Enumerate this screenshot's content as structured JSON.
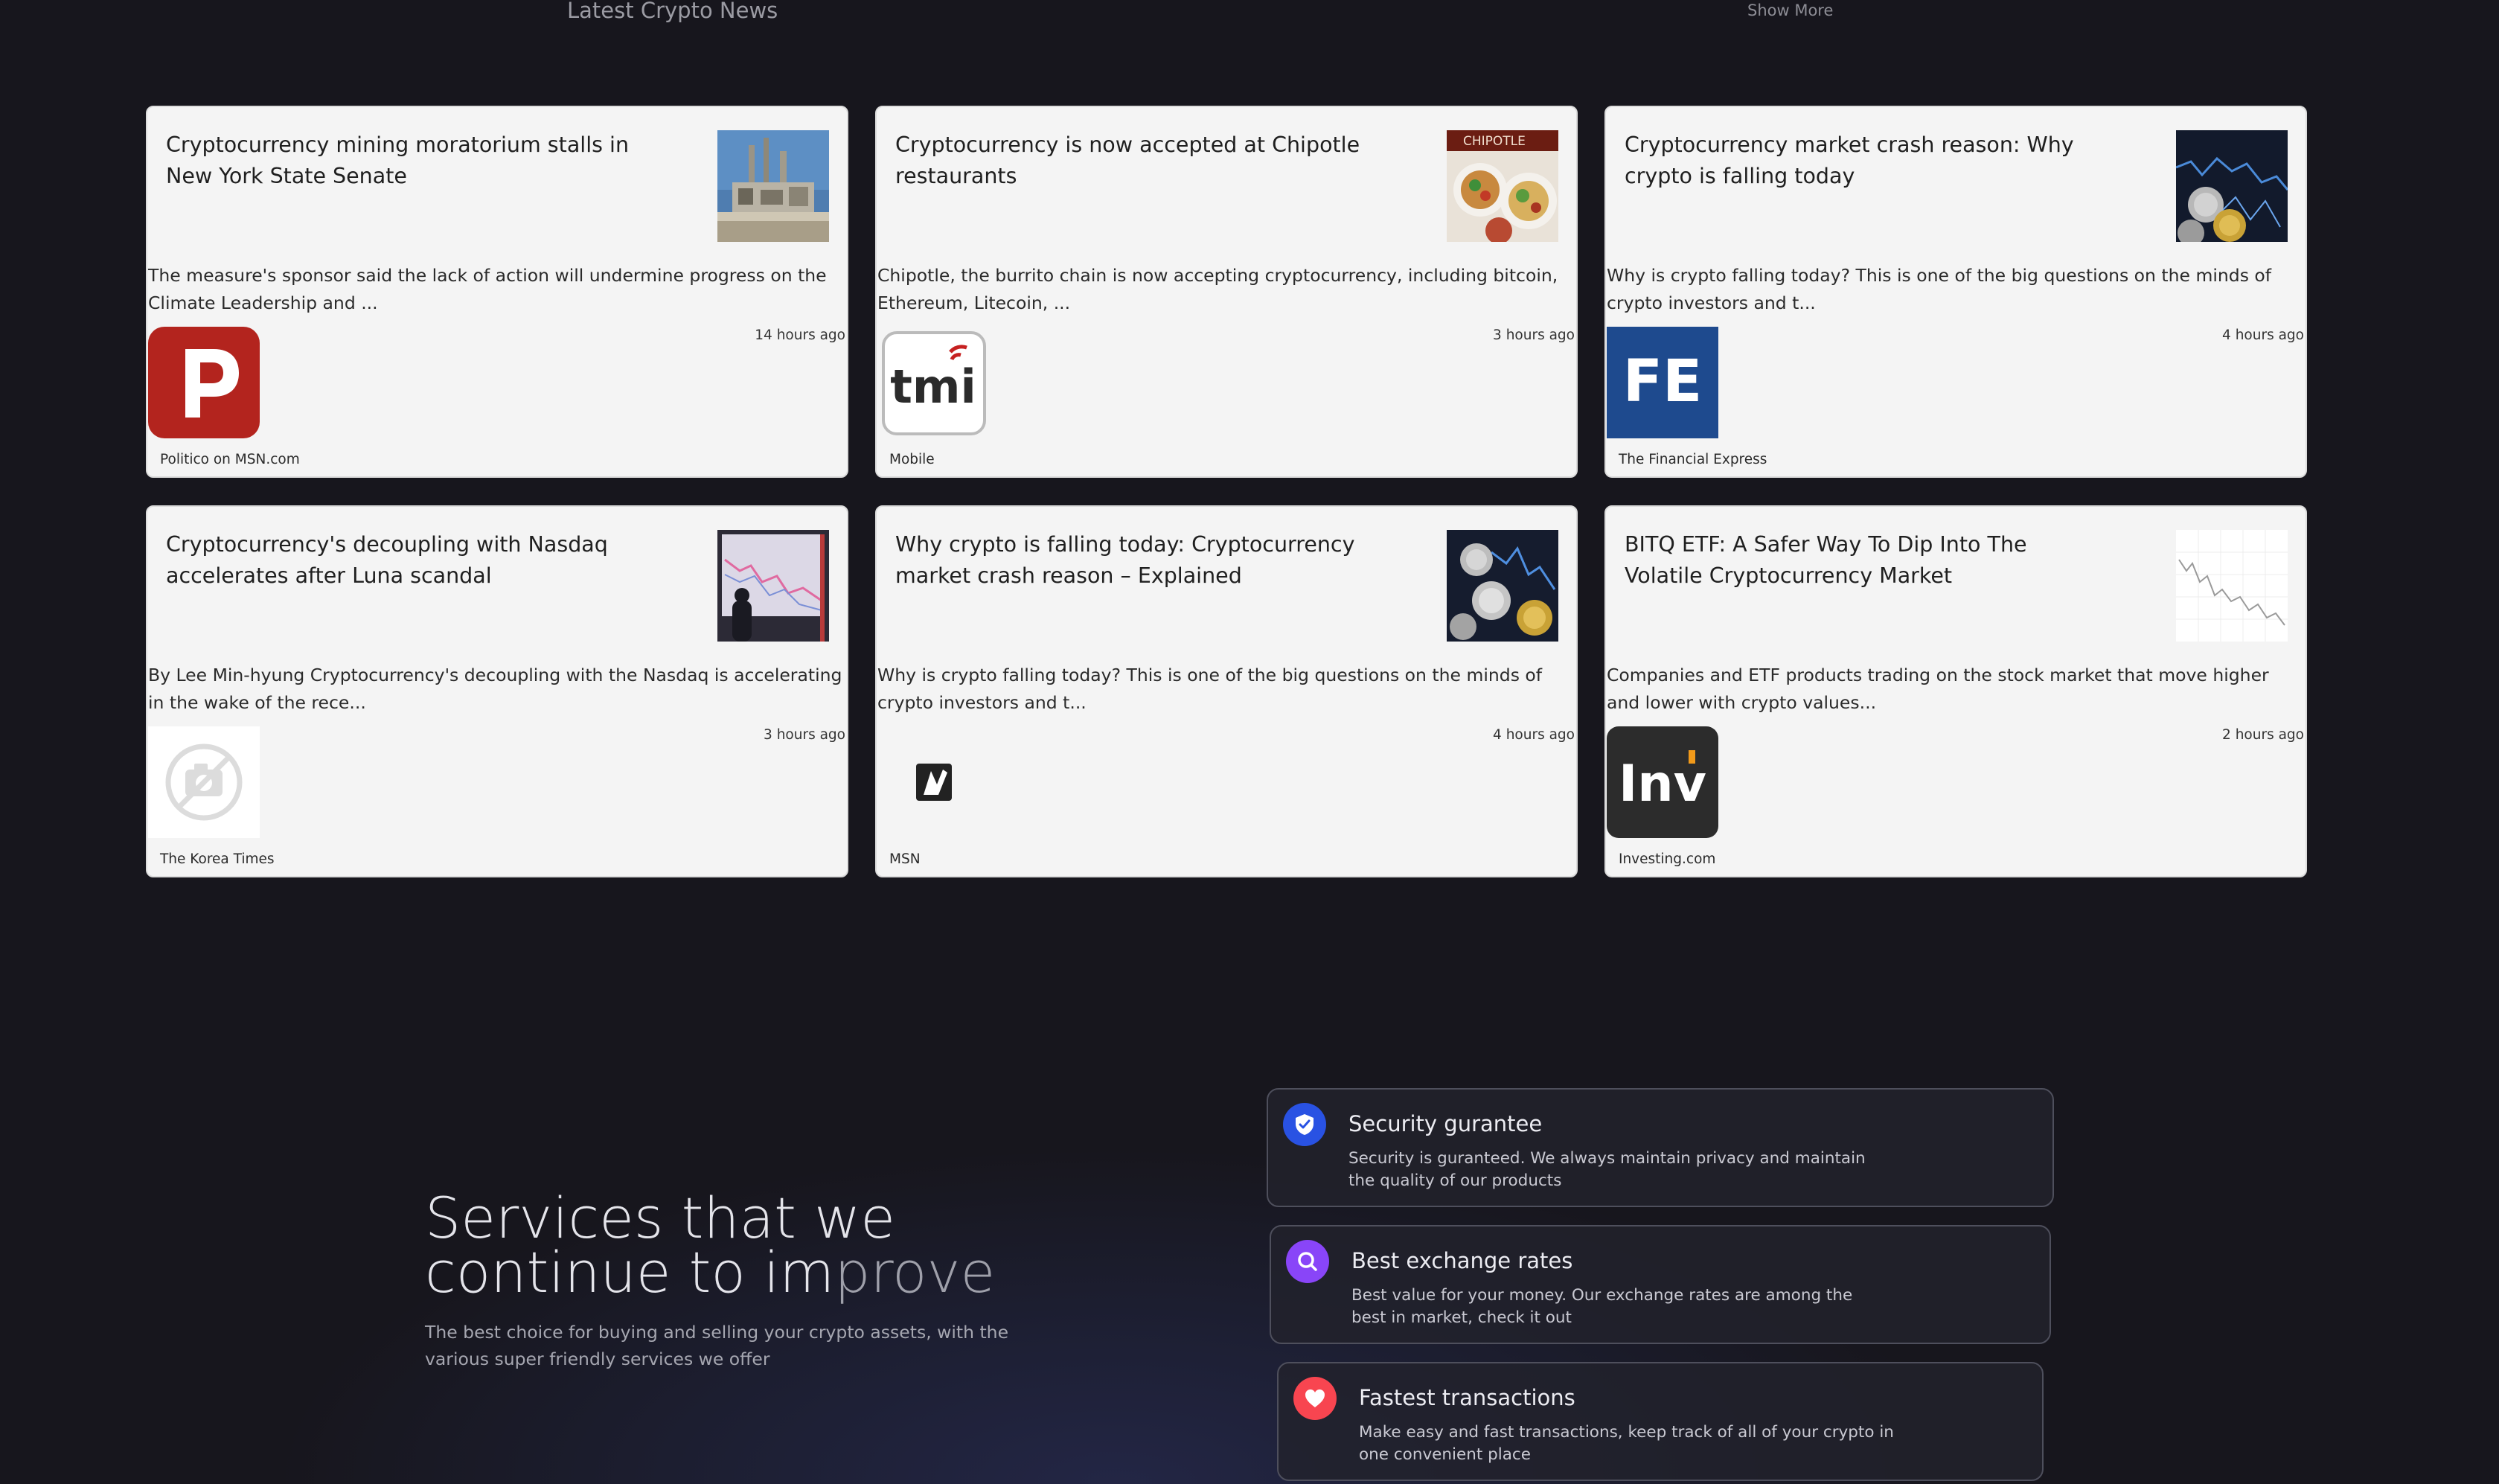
{
  "news": {
    "title": "Latest Crypto News",
    "show_more": "Show More",
    "articles": [
      {
        "headline": "Cryptocurrency mining moratorium stalls in New York State Senate",
        "snippet": "The measure's sponsor said the lack of action will undermine progress on the Climate Leadership and ...",
        "time": "14 hours ago",
        "provider": "Politico on MSN.com",
        "thumb_icon": "power-plant-photo",
        "provider_icon": "politico-logo-icon"
      },
      {
        "headline": "Cryptocurrency is now accepted at Chipotle restaurants",
        "snippet": "Chipotle, the burrito chain is now accepting cryptocurrency, including bitcoin, Ethereum, Litecoin, ...",
        "time": "3 hours ago",
        "provider": "Mobile",
        "thumb_icon": "chipotle-food-photo",
        "thumb_text": "CHIPOTLE",
        "provider_icon": "tmi-logo-icon",
        "provider_logo_text": "tmi"
      },
      {
        "headline": "Cryptocurrency market crash reason: Why crypto is falling today",
        "snippet": "Why is crypto falling today? This is one of the big questions on the minds of crypto investors and t...",
        "time": "4 hours ago",
        "provider": "The Financial Express",
        "thumb_icon": "crypto-coins-chart-photo",
        "provider_icon": "financial-express-logo-icon",
        "provider_logo_text": "FE"
      },
      {
        "headline": "Cryptocurrency's decoupling with Nasdaq accelerates after Luna scandal",
        "snippet": "By Lee Min-hyung Cryptocurrency's decoupling with the Nasdaq is accelerating in the wake of the rece...",
        "time": "3 hours ago",
        "provider": "The Korea Times",
        "thumb_icon": "market-screen-photo",
        "provider_icon": "camera-placeholder-icon"
      },
      {
        "headline": "Why crypto is falling today: Cryptocurrency market crash reason – Explained",
        "snippet": "Why is crypto falling today? This is one of the big questions on the minds of crypto investors and t...",
        "time": "4 hours ago",
        "provider": "MSN",
        "thumb_icon": "crypto-coins-chart-photo",
        "provider_icon": "msn-logo-icon"
      },
      {
        "headline": "BITQ ETF: A Safer Way To Dip Into The Volatile Cryptocurrency Market",
        "snippet": "Companies and ETF products trading on the stock market that move higher and lower with crypto values...",
        "time": "2 hours ago",
        "provider": "Investing.com",
        "thumb_icon": "stock-chart-photo",
        "provider_icon": "investing-logo-icon",
        "provider_logo_text": "Inv"
      }
    ]
  },
  "services": {
    "heading_line1": "Services that we",
    "heading_line2_a": "continue to im",
    "heading_line2_b": "prove",
    "subtitle": "The best choice for buying and selling your crypto assets, with the various super friendly services we offer",
    "items": [
      {
        "title": "Security gurantee",
        "description": "Security is guranteed. We always maintain privacy and maintain the quality of our products",
        "icon": "shield-check-icon",
        "color": "#2952e3"
      },
      {
        "title": "Best exchange rates",
        "description": "Best value for your money. Our exchange rates are among the best in market, check it out",
        "icon": "search-icon",
        "color": "#8945f8"
      },
      {
        "title": "Fastest transactions",
        "description": "Make easy and fast transactions, keep track of all of your crypto in one convenient place",
        "icon": "heart-icon",
        "color": "#f84550"
      }
    ]
  }
}
